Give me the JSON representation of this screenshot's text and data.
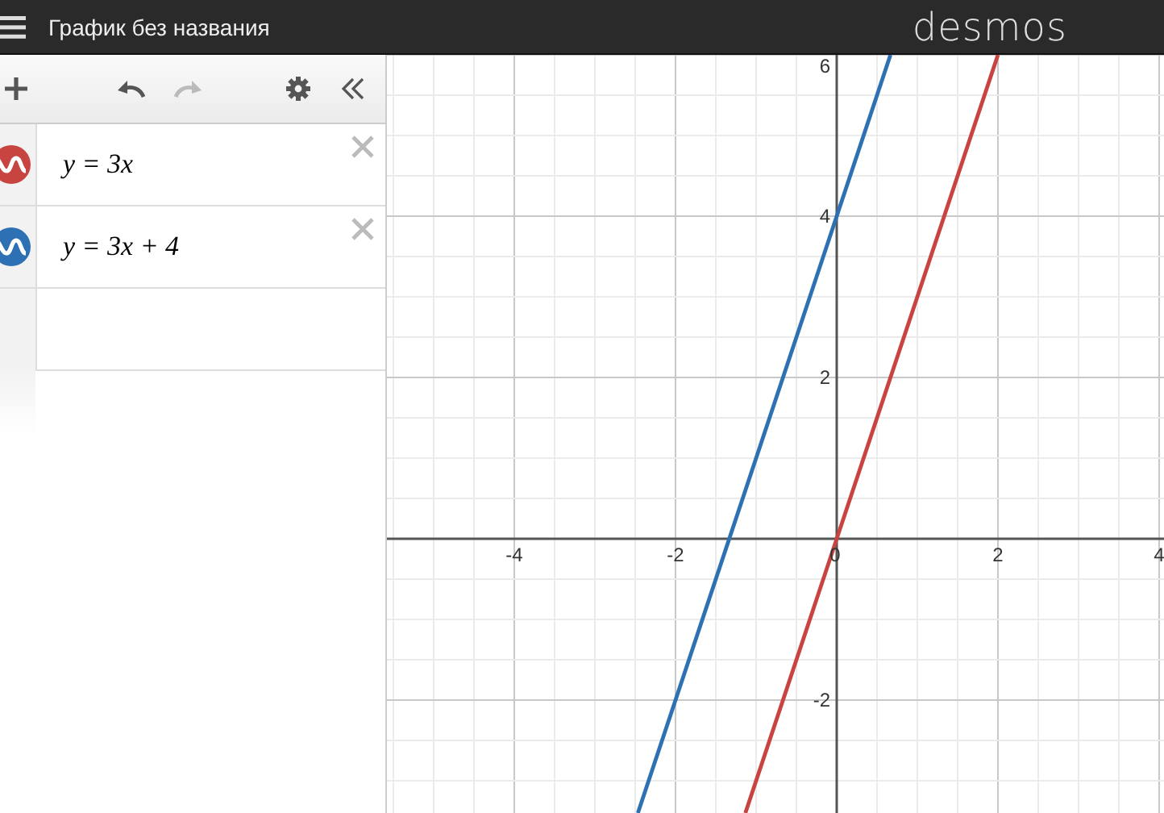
{
  "header": {
    "title": "График без названия",
    "brand": "desmos"
  },
  "toolbar": {
    "undo_disabled": false,
    "redo_disabled": true
  },
  "graph": {
    "chart_data": {
      "type": "line",
      "x": [
        -2.4667,
        -1.1333,
        0.6667,
        2
      ],
      "xlim": [
        -5.58,
        4.06
      ],
      "ylim": [
        -3.4,
        6
      ],
      "xticks": [
        -4,
        -2,
        0,
        2,
        4
      ],
      "yticks": [
        -2,
        2,
        4,
        6
      ],
      "grid": true,
      "series": [
        {
          "name": "y = 3x",
          "color": "#c74440",
          "values": [
            null,
            -3.4,
            2,
            6
          ]
        },
        {
          "name": "y = 3x + 4",
          "color": "#2d70b3",
          "values": [
            -3.4,
            0.6,
            6,
            null
          ]
        }
      ]
    }
  }
}
